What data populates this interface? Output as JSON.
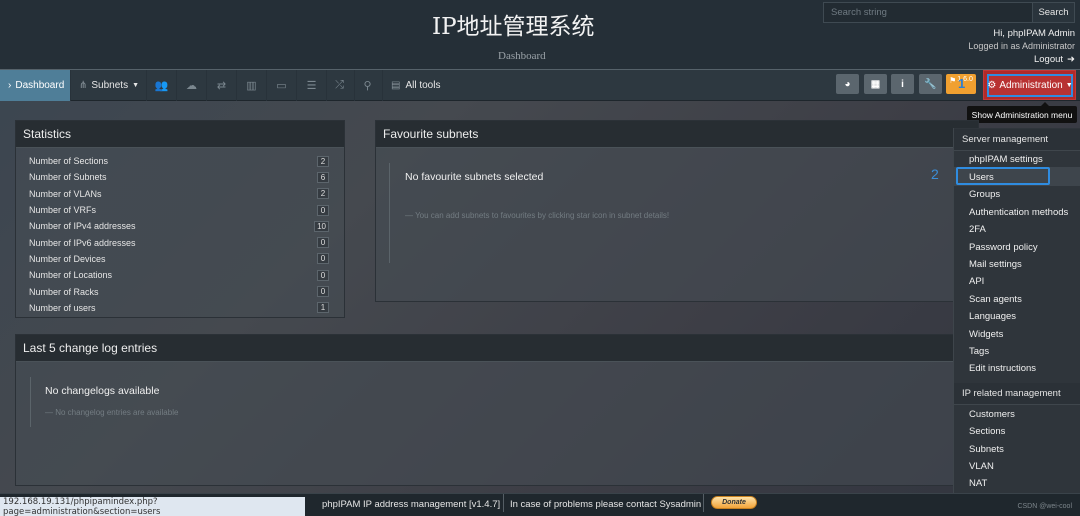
{
  "header": {
    "title": "IP地址管理系统",
    "subtitle": "Dashboard",
    "search_placeholder": "Search string",
    "search_button": "Search",
    "greeting": "Hi, phpIPAM Admin",
    "logged_in": "Logged in as  Administrator",
    "logout": "Logout"
  },
  "navbar": {
    "dashboard": "Dashboard",
    "subnets": "Subnets",
    "all_tools": "All tools",
    "icons": [
      "users-icon",
      "cloud-icon",
      "exchange-icon",
      "map-icon",
      "monitor-icon",
      "list-icon",
      "random-icon",
      "search-icon"
    ],
    "update_version": "1.6.0",
    "annotation_1": "1",
    "administration": "Administration",
    "tooltip": "Show Administration menu"
  },
  "statistics": {
    "title": "Statistics",
    "rows": [
      {
        "label": "Number of Sections",
        "value": "2"
      },
      {
        "label": "Number of Subnets",
        "value": "6"
      },
      {
        "label": "Number of VLANs",
        "value": "2"
      },
      {
        "label": "Number of VRFs",
        "value": "0"
      },
      {
        "label": "Number of IPv4 addresses",
        "value": "10"
      },
      {
        "label": "Number of IPv6 addresses",
        "value": "0"
      },
      {
        "label": "Number of Devices",
        "value": "0"
      },
      {
        "label": "Number of Locations",
        "value": "0"
      },
      {
        "label": "Number of Racks",
        "value": "0"
      },
      {
        "label": "Number of users",
        "value": "1"
      }
    ]
  },
  "favourites": {
    "title": "Favourite subnets",
    "empty_title": "No favourite subnets selected",
    "empty_hint": "— You can add subnets to favourites by clicking star icon in subnet details!",
    "annotation_2": "2"
  },
  "changelog": {
    "title": "Last 5 change log entries",
    "empty_title": "No changelogs available",
    "empty_hint": "— No changelog entries are available"
  },
  "admin_menu": {
    "server_header": "Server management",
    "server_items": [
      "phpIPAM settings",
      "Users",
      "Groups",
      "Authentication methods",
      "2FA",
      "Password policy",
      "Mail settings",
      "API",
      "Scan agents",
      "Languages",
      "Widgets",
      "Tags",
      "Edit instructions"
    ],
    "ip_header": "IP related management",
    "ip_items": [
      "Customers",
      "Sections",
      "Subnets",
      "VLAN",
      "NAT"
    ]
  },
  "footer": {
    "status_url": "192.168.19.131/phpipamindex.php?page=administration&section=users",
    "app_version": "phpIPAM IP address management [v1.4.7]",
    "contact": "In case of problems please contact Sysadmin",
    "donate": "Donate",
    "watermark": "CSDN @wei-cool"
  }
}
